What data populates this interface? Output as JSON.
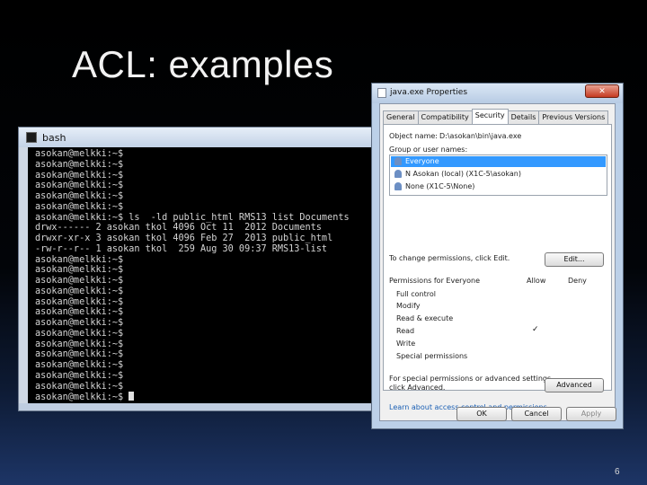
{
  "slide": {
    "title": "ACL: examples",
    "page_number": "6"
  },
  "terminal": {
    "title": "bash",
    "lines": [
      "asokan@melkki:~$",
      "asokan@melkki:~$",
      "asokan@melkki:~$",
      "asokan@melkki:~$",
      "asokan@melkki:~$",
      "asokan@melkki:~$",
      "asokan@melkki:~$ ls  -ld public_html RMS13 list Documents",
      "drwx------ 2 asokan tkol 4096 Oct 11  2012 Documents",
      "drwxr-xr-x 3 asokan tkol 4096 Feb 27  2013 public_html",
      "-rw-r--r-- 1 asokan tkol  259 Aug 30 09:37 RMS13-list",
      "asokan@melkki:~$",
      "asokan@melkki:~$",
      "asokan@melkki:~$",
      "asokan@melkki:~$",
      "asokan@melkki:~$",
      "asokan@melkki:~$",
      "asokan@melkki:~$",
      "asokan@melkki:~$",
      "asokan@melkki:~$",
      "asokan@melkki:~$",
      "asokan@melkki:~$",
      "asokan@melkki:~$",
      "asokan@melkki:~$",
      "asokan@melkki:~$"
    ]
  },
  "dialog": {
    "title": "java.exe Properties",
    "tabs": [
      "General",
      "Compatibility",
      "Security",
      "Details",
      "Previous Versions"
    ],
    "active_tab": "Security",
    "object_name_label": "Object name:",
    "object_name_value": "D:\\asokan\\bin\\java.exe",
    "group_label": "Group or user names:",
    "users": [
      {
        "name": "Everyone",
        "selected": true
      },
      {
        "name": "N Asokan (local) (X1C-5\\asokan)",
        "selected": false
      },
      {
        "name": "None (X1C-5\\None)",
        "selected": false
      }
    ],
    "change_text": "To change permissions, click Edit.",
    "edit_button": "Edit...",
    "permissions_header": "Permissions for Everyone",
    "allow_header": "Allow",
    "deny_header": "Deny",
    "permissions": [
      {
        "name": "Full control",
        "allow": false,
        "deny": false
      },
      {
        "name": "Modify",
        "allow": false,
        "deny": false
      },
      {
        "name": "Read & execute",
        "allow": false,
        "deny": false
      },
      {
        "name": "Read",
        "allow": true,
        "deny": false
      },
      {
        "name": "Write",
        "allow": false,
        "deny": false
      },
      {
        "name": "Special permissions",
        "allow": false,
        "deny": false
      }
    ],
    "check_mark": "✓",
    "special_text_1": "For special permissions or advanced settings,",
    "special_text_2": "click Advanced.",
    "advanced_button": "Advanced",
    "learn_link": "Learn about access control and permissions",
    "ok_button": "OK",
    "cancel_button": "Cancel",
    "apply_button": "Apply",
    "close_glyph": "✕"
  }
}
